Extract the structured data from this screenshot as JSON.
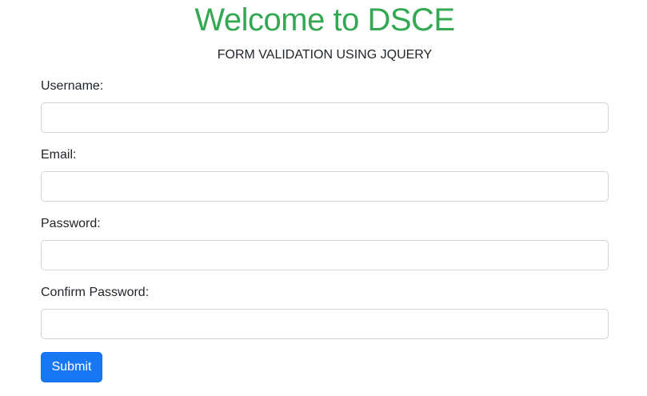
{
  "header": {
    "title": "Welcome to DSCE",
    "subtitle": "FORM VALIDATION USING JQUERY"
  },
  "form": {
    "username": {
      "label": "Username:",
      "value": "",
      "placeholder": ""
    },
    "email": {
      "label": "Email:",
      "value": "",
      "placeholder": ""
    },
    "password": {
      "label": "Password:",
      "value": "",
      "placeholder": ""
    },
    "confirm_password": {
      "label": "Confirm Password:",
      "value": "",
      "placeholder": ""
    },
    "submit_label": "Submit"
  },
  "colors": {
    "title": "#34a853",
    "button": "#1877f2",
    "input_border": "#ced4da"
  }
}
